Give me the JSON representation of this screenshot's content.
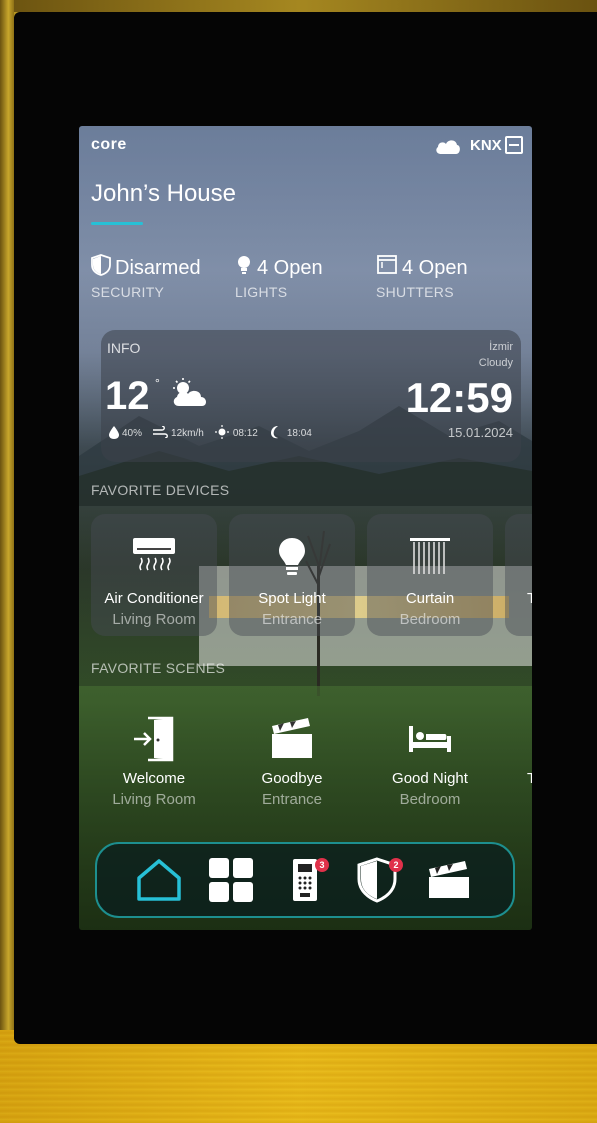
{
  "screen": {
    "logo": "core",
    "cloud_status": "KNX",
    "title": "John’s House",
    "status": [
      {
        "value": "Disarmed",
        "label": "SECURITY",
        "icon": "shield-icon"
      },
      {
        "value": "4 Open",
        "label": "LIGHTS",
        "icon": "bulb-icon"
      },
      {
        "value": "4 Open",
        "label": "SHUTTERS",
        "icon": "shutter-icon"
      }
    ],
    "info": {
      "header": "INFO",
      "city": "İzmir",
      "condition": "Cloudy",
      "temperature": "12",
      "degree": "°",
      "humidity": "40%",
      "wind": "12km/h",
      "sunrise": "08:12",
      "sunset": "18:04",
      "time": "12:59",
      "date": "15.01.2024"
    },
    "favorite_devices_label": "FAVORITE DEVICES",
    "favorite_devices": [
      {
        "name": "Air Conditioner",
        "room": "Living Room",
        "icon": "air-conditioner-icon"
      },
      {
        "name": "Spot Light",
        "room": "Entrance",
        "icon": "bulb-icon"
      },
      {
        "name": "Curtain",
        "room": "Bedroom",
        "icon": "curtain-icon"
      },
      {
        "name": "T",
        "room": "",
        "icon": ""
      }
    ],
    "favorite_scenes_label": "FAVORITE SCENES",
    "favorite_scenes": [
      {
        "name": "Welcome",
        "room": "Living Room",
        "icon": "door-enter-icon"
      },
      {
        "name": "Goodbye",
        "room": "Entrance",
        "icon": "clapperboard-icon"
      },
      {
        "name": "Good Night",
        "room": "Bedroom",
        "icon": "bed-icon"
      },
      {
        "name": "T",
        "room": "",
        "icon": ""
      }
    ],
    "dock": [
      {
        "icon": "home-icon",
        "badge": ""
      },
      {
        "icon": "grid-icon",
        "badge": ""
      },
      {
        "icon": "intercom-icon",
        "badge": "3"
      },
      {
        "icon": "shield-icon",
        "badge": "2"
      },
      {
        "icon": "clapperboard-icon",
        "badge": ""
      }
    ],
    "colors": {
      "accent": "#27c0d6",
      "dock_border": "#1d8f8f",
      "badge": "#e0314a"
    }
  }
}
